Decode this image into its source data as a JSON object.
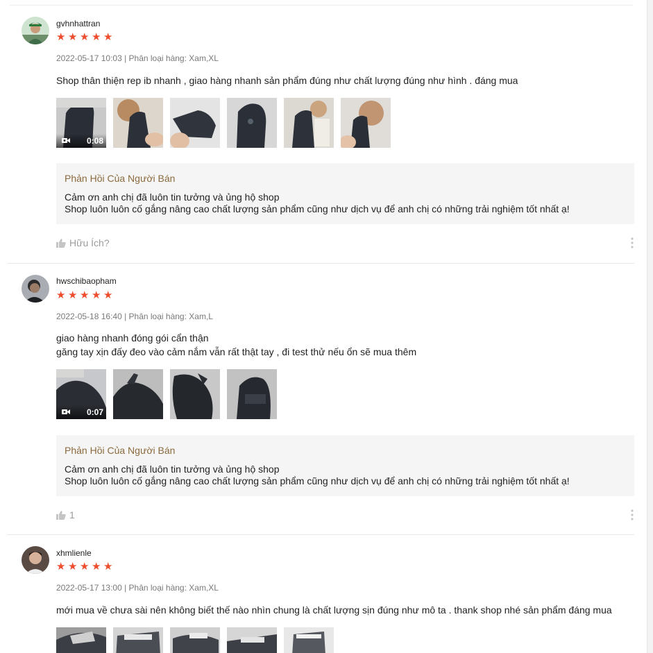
{
  "colors": {
    "star": "#ee4d2d",
    "reply_title": "#8a6a3e",
    "reply_bg": "#f5f5f5",
    "meta": "#8a8a8a"
  },
  "reviews": [
    {
      "username": "gvhnhattran",
      "rating": 5,
      "meta": "2022-05-17 10:03 | Phân loại hàng: Xam,XL",
      "content": [
        "Shop thân thiện rep ib nhanh , giao hàng nhanh sản phẩm đúng như chất lượng đúng như hình . đáng mua"
      ],
      "video_duration": "0:08",
      "reply": {
        "title": "Phản Hồi Của Người Bán",
        "lines": [
          "Cảm ơn anh chị đã luôn tin tưởng và ủng hộ shop",
          "Shop luôn luôn cố gắng nâng cao chất lượng sản phẩm cũng như dịch vụ để anh chị có những trải nghiệm tốt nhất ạ!"
        ]
      },
      "like_label": "Hữu Ích?"
    },
    {
      "username": "hwschibaopham",
      "rating": 5,
      "meta": "2022-05-18 16:40 | Phân loại hàng: Xam,L",
      "content": [
        "giao hàng nhanh đóng gói cẩn thận",
        "găng tay xịn đấy đeo vào cảm nắm vẫn rất thật tay , đi test thử nếu ổn sẽ mua thêm"
      ],
      "video_duration": "0:07",
      "reply": {
        "title": "Phản Hồi Của Người Bán",
        "lines": [
          "Cảm ơn anh chị đã luôn tin tưởng và ủng hộ shop",
          "Shop luôn luôn cố gắng nâng cao chất lượng sản phẩm cũng như dịch vụ để anh chị có những trải nghiệm tốt nhất ạ!"
        ]
      },
      "like_label": "1"
    },
    {
      "username": "xhmlienle",
      "rating": 5,
      "meta": "2022-05-17 13:00 | Phân loại hàng: Xam,XL",
      "content": [
        "mới mua về chưa sài nên không biết thế nào nhìn chung là chất lượng sịn đúng như mô ta . thank shop nhé sản phẩm đáng mua"
      ]
    }
  ]
}
